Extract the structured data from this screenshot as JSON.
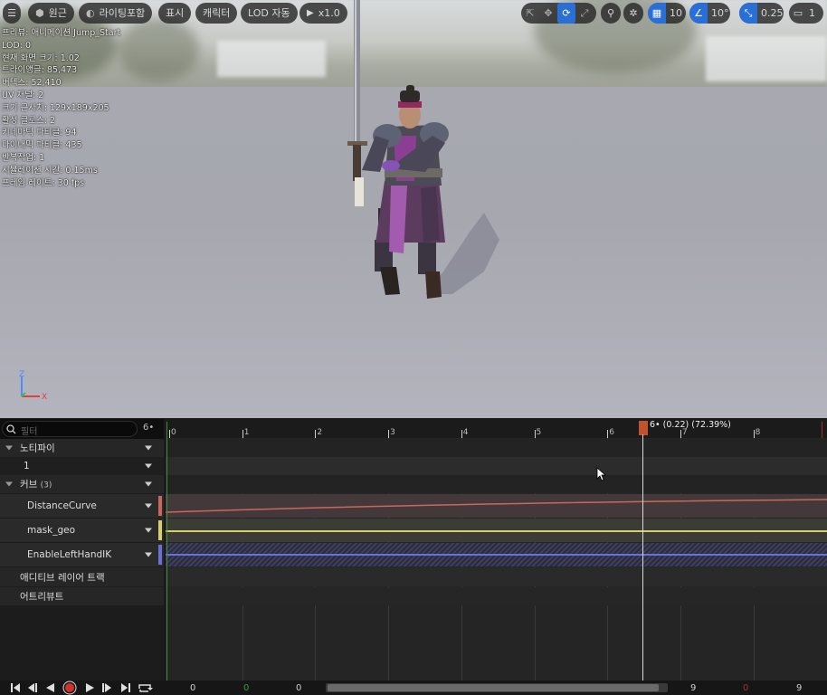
{
  "toolbar": {
    "perspective_label": "원근",
    "lighting_label": "라이팅포함",
    "show_label": "표시",
    "character_label": "캐릭터",
    "lod_label": "LOD 자동",
    "play_rate_label": "x1.0",
    "grid_snap_value": "10",
    "rotation_snap_value": "10°",
    "scale_snap_value": "0.25",
    "camera_speed_value": "1"
  },
  "stats": [
    "프리뷰: 애니메이션 Jump_Start",
    "LOD: 0",
    "현재 화면 크기: 1.02",
    "트라이앵글: 85,473",
    "버텍스: 52,410",
    "UV 채널: 2",
    "크기 근사치: 129x189x205",
    "활성 클로스: 2",
    "키네마틱 파티클: 94",
    "다이내믹 파티클: 435",
    "반복작업: 1",
    "시뮬레이션 시간: 0.15ms",
    "프레임 레이트: 30 fps"
  ],
  "axis": {
    "z": "Z",
    "x": "X"
  },
  "filter": {
    "placeholder": "필터",
    "count": "6•"
  },
  "tracks": {
    "notifies_label": "노티파이",
    "notify_track_1": "1",
    "curves_label": "커브",
    "curves_count": "(3)",
    "curves": [
      {
        "name": "DistanceCurve",
        "color": "#c8685c"
      },
      {
        "name": "mask_geo",
        "color": "#d7d06a"
      },
      {
        "name": "EnableLeftHandIK",
        "color": "#6a70d8"
      }
    ],
    "additive_label": "애디티브 레이어 트랙",
    "attributes_label": "어트리뷰트"
  },
  "ruler": {
    "ticks": [
      "0",
      "1",
      "2",
      "3",
      "4",
      "5",
      "6",
      "7",
      "8"
    ],
    "playhead_label": "6• (0.22) (72.39%)"
  },
  "transport": {
    "frame_values": [
      "0",
      "0",
      "0",
      "9",
      "0",
      "9"
    ]
  }
}
